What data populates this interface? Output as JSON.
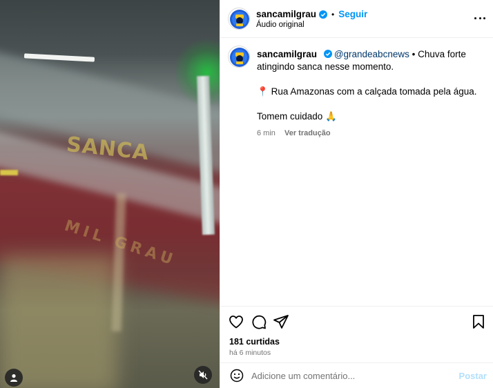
{
  "post": {
    "username": "sancamilgrau",
    "follow_label": "Seguir",
    "dot": "•",
    "audio_label": "Áudio original"
  },
  "caption": {
    "username": "sancamilgrau",
    "mention": "@grandeabcnews",
    "line1_rest": " • Chuva forte atingindo sanca nesse momento.",
    "pin_emoji": "📍",
    "line2": " Rua Amazonas com a calçada tomada pela água.",
    "line3": "Tomem cuidado",
    "pray_emoji": "🙏",
    "time": "6 min",
    "translate_label": "Ver tradução"
  },
  "engagement": {
    "likes": "181 curtidas",
    "time_ago": "há 6 minutos"
  },
  "comment_box": {
    "placeholder": "Adicione um comentário...",
    "post_label": "Postar"
  },
  "media": {
    "watermark": "SANCA",
    "watermark2": "MIL GRAU"
  },
  "colors": {
    "accent": "#0095f6",
    "verified": "#0095f6",
    "mention": "#00376b",
    "secondary_text": "#737373",
    "post_disabled": "#b2dffc"
  },
  "icons": [
    "verified-icon",
    "more-options-icon",
    "heart-icon",
    "comment-icon",
    "share-icon",
    "bookmark-icon",
    "emoji-icon",
    "user-tag-icon",
    "muted-speaker-icon"
  ]
}
